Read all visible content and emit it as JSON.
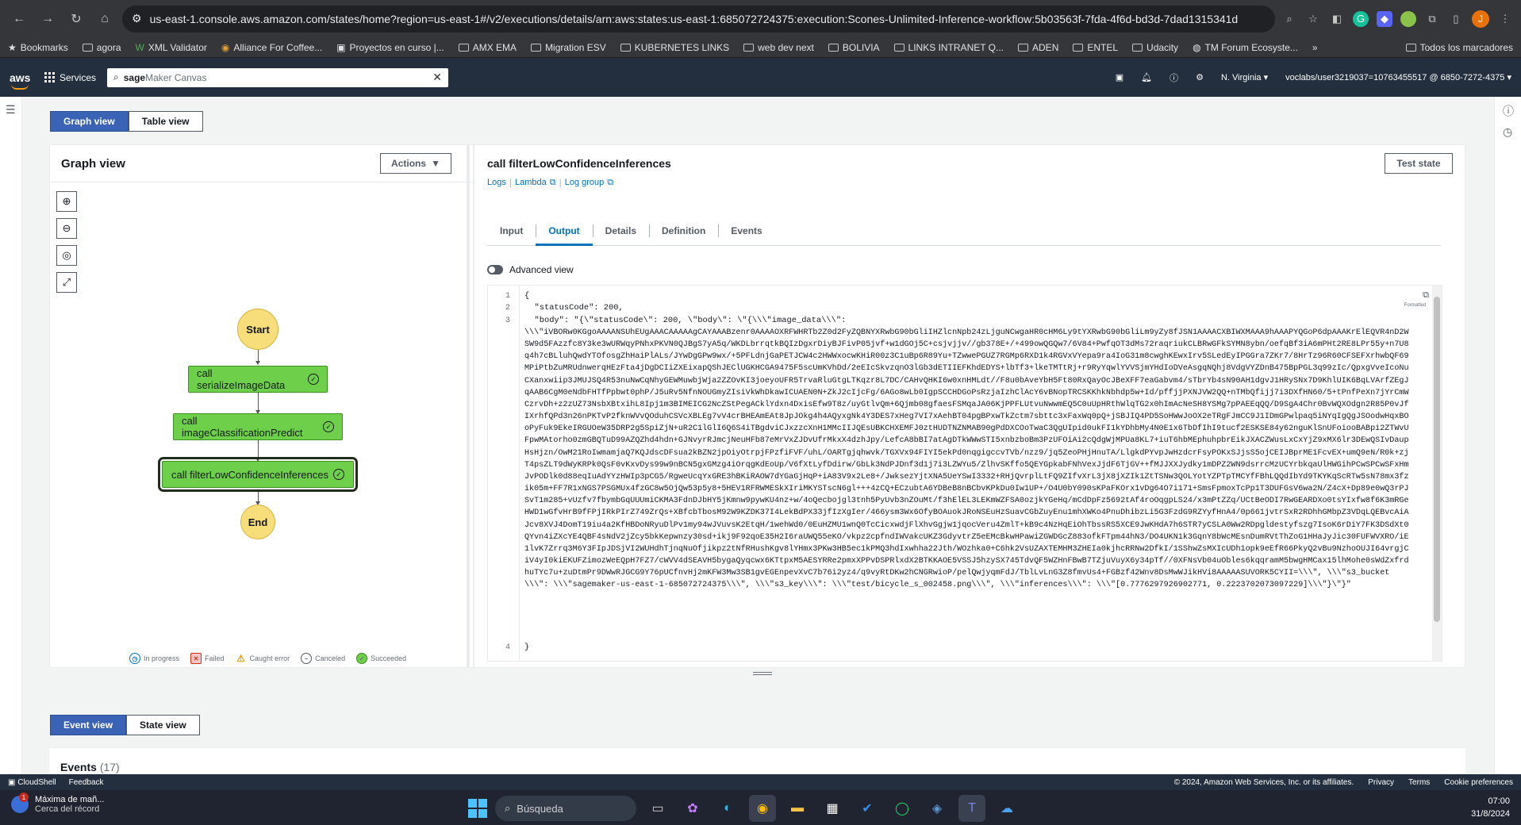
{
  "browser": {
    "url": "us-east-1.console.aws.amazon.com/states/home?region=us-east-1#/v2/executions/details/arn:aws:states:us-east-1:685072724375:execution:Scones-Unlimited-Inference-workflow:5b03563f-7fda-4f6d-bd3d-7dad1315341d",
    "bookmarks": [
      "Bookmarks",
      "agora",
      "XML Validator",
      "Alliance For Coffee...",
      "Proyectos en curso |...",
      "AMX EMA",
      "Migration ESV",
      "KUBERNETES LINKS",
      "web dev next",
      "BOLIVIA",
      "LINKS INTRANET Q...",
      "ADEN",
      "ENTEL",
      "Udacity",
      "TM Forum Ecosyste..."
    ],
    "more_bookmarks": "»",
    "all_bookmarks": "Todos los marcadores",
    "profile_initial": "J"
  },
  "aws_header": {
    "logo": "aws",
    "services": "Services",
    "search_highlight": "sage",
    "search_rest": "Maker Canvas",
    "region": "N. Virginia ▾",
    "account": "voclabs/user3219037=10763455517 @ 6850-7272-4375 ▾"
  },
  "view_toggle": {
    "graph": "Graph view",
    "table": "Table view"
  },
  "graph_panel": {
    "title": "Graph view",
    "actions": "Actions",
    "nodes": {
      "start": "Start",
      "serialize": "call serializeImageData",
      "classify": "call imageClassificationPredict",
      "filter": "call filterLowConfidenceInferences",
      "end": "End"
    },
    "legend": [
      "In progress",
      "Failed",
      "Caught error",
      "Canceled",
      "Succeeded"
    ]
  },
  "details_panel": {
    "title": "call filterLowConfidenceInferences",
    "links": [
      "Logs",
      "Lambda",
      "Log group"
    ],
    "test_state": "Test state",
    "tabs": [
      "Input",
      "Output",
      "Details",
      "Definition",
      "Events"
    ],
    "active_tab": "Output",
    "advanced_view": "Advanced view",
    "formatted_label": "Formatted",
    "code_lines": [
      "1",
      "2",
      "3",
      "4"
    ],
    "code": {
      "line1": "{",
      "line2": "  \"statusCode\": 200,",
      "line3_head": "  \"body\": \"{\\\"statusCode\\\": 200, \\\"body\\\": \\\"{\\\\\\\"image_data\\\\\\\":",
      "line3_blob": "\\\\\\\"iVBORw0KGgoAAAANSUhEUgAAACAAAAAgCAYAAABzenr0AAAAOXRFWHRTb2Z0d2FyZQBNYXRwbG90bGliIHZlcnNpb24zLjguNCwgaHR0cHM6Ly9tYXRwbG90bGliLm9yZy8fJSN1AAAACXBIWXMAAA9hAAAPYQGoP6dpAAAKrElEQVR4nD2WSW9d5FAzzfc8Y3ke3wURWqyPNhxPKVN0QJBgS7yA5q/WKDLbrrqtkBQIzDgxrDiyBJFivP05jvf+w1dGOj5C+csjvjjv//gb378E+/+499owQGQw7/6V84+PwfqOT3dMs72raqriukCLBRwGFkSYMN8ybn/oefqBf3iA6mPHt2RE8LPr55y+n7U8q4h7cBLluhQwdYTOfosgZhHaiPlALs/JYwDgGPw9wx/+5PFLdnjGaPETJCW4c2HWWxocwKHiR00z3C1uBp6R89Yu+TZwwePGUZ7RGMp6RXD1k4RGVxVYepa9ra4IoG31m8cwghKEwxIrv5SLedEyIPGGra7ZKr7/8HrTz96R60CFSEFXrhwbQF69MPiPtbZuMRUdnwerqHEzFta4jDgDCIiZXEixapQShJEClUGKHCGA9475F5scUmKVhDd/2eEIcSkvzqnO3lGb3dETIIEFKhdEDYS+lbTf3+lkeTMTtRj+r9RyYqwlYVVSjmYHdIoDVeAsgqNQhj8VdgVYZDnB475BpPGL3q99zIc/QpxgVveIcoNuCXanxwiip3JMUJSQ4R53nuNwCqNhyGEWMuwbjWja2ZZOvKI3joeyoUFR5TrvaRluGtgLTKqzr8L7DC/CAHvQHKI6w0xnHMLdt//F8u0bAveYbH5Ft80RxQayOcJBeXFF7eaGabvm4/sTbrYb4sN90AH1dgvJ1HRySNx7D9KhlUIK6BqLVArfZEgJqAAB6CgM0eNdbFHTfPpbwt0phP/J5uRv5NfnNOUGmyZIsiVkWhDkawICUAEN0N+ZkJ2cIjcFg/6AGo8wLb0IgpSCCHDGoPsRzjaIzhClAcY6vBNopTRCSKKhkNbhdp5w+Id/pffjjPXNJVW2QQ+nTMbQfijj7i3DXfHN60/5+tPnfPeXn7jYrCmWCzrvDh+z2zUZ73NsbXBtxihL8Ipj1m3BIMEICG2NcZStPegACklYdxn4DxisEfw9T8z/uyGtlvQm+6Qjmb08gfaesFSMqaJA06KjPPFLUtvuNwwmEQ5C0uUpHRthWlqTG2x0hImAcNeSH8YSMg7pPAEEqQQ/D9SgA4Chr0BvWQXOdgn2R85P0vJfIXrhfQPd3n26nPKTvP2fknWVvQOduhCSVcXBLEg7vV4crBHEAmEAt8JpJOkg4h4AQyxgNk4Y3DES7xHeg7VI7xAehBT04pgBPxwTkZctm7sbttc3xFaxWq0pQ+jSBJIQ4PD5SoHWwJoOX2eTRgFJmCC9J1IDmGPwlpaq5iNYqIgQgJSOodwHqxBOoPyFuk9EkeIRGUOeW35DRP2g5SpiZjN+uR2C1lGlI6Q6S4iTBgdviCJxzzcXnH1MMcIIJQEsUBKCHXEMFJ0ztHUDTNZNMAB90gPdDXCOoTwaC3QgUIpid0ukFI1kYDhbMy4N0E1x6TbDfIhI9tucf2ESKSE84y62nguKlSnUFoiooBABpi2ZTWvUFpwMAtorho0zmGBQTuD99AZQZhd4hdn+GJNvyrRJmcjNeuHFb87eMrVxZJDvUfrMkxX4dzhJpy/LefcA8bBI7atAgDTkWWwSTI5xnbzboBm3PzUFOiAi2cQdgWjMPUa8KL7+iuT6hbMEphuhpbrEikJXACZWusLxCxYjZ9xMX6lr3DEwQSIvDaupHsHjzn/OwM21RoIwmamjaQ7KQJdscDFsua2kBZN2jpOiyOtrpjFPzfiFVF/uhL/OARTgjqhwvk/TGXVx94FIYI5ekPd0nqgigccvTVb/nzz9/jq5ZeoPHjHnuTA/LlgkdPYvpJwHzdcrFsyPOKxSJjsS5ojCEIJBprME1FcvEX+umQ9eN/R0k+zjT4psZLT9dWyKRPk0QsF0vKxvDys99w9nBCN5gxGMzg4iOrqgKdEoUp/V6fXtLyfDdirw/GbLk3NdPJDnf3d1j7i3LZWYu5/ZlhvSKffo5QEYGpkabFNhVexJjdF6TjGV++fMJJXXJydky1mDPZ2WN9dsrrcMzUCYrbkqaUlHWGihPCwSPCwSFxHmJvPODlk0d88eqIuAdYYzHWIp3pCG5/RgweUcqYxGRE3hBKiRAOW7dYGaGjHqP+iA83V9x2Le8+/JwksezYjtXNA5UeYSwI3332+RHjQvrplLtFQ9ZIfvXrL3jX8jXZIk1ZtTSNw3QOLYotYZPTpTMCYfFBhLQQdIbYd9TKYKqScRTw5sN78mx3fzik05m+FF7R1xNGS7PSGMUx4fzGC8w5OjQw53p5y8+5HEV1RFRWMESkXIriMKYSTscN6gl+++4zCQ+ECzubtA6YDBeB8nBCbvKPkDu0Iw1UP+/O4U0bY090sKPaFKOrx1vDg64O7i171+SmsFpmoxTcPp1T3DUFGsV6wa2N/Z4cX+Dp89e0wQ3rPJSvT1m285+vUzfv7fbymbGqUUUmiCKMA3FdnDJbHY5jKmnw9pywKU4nz+w/4oQecbojgl3tnh5PyUvb3nZOuMt/f3hElEL3LEKmWZFSA0ozjkYGeHq/mCdDpFz5692tAf4roOqgpLS24/x3mPtZZq/UCtBeODI7RwGEARDXo0tsYIxfw8f6K3mRGeHWD1wGfvHrB9fFPjIRkPIrZ749ZrQs+XBfcbTbosM92W9KZDK37I4LekBdPX33jfIzXgIer/466ysm3Wx6OfyBOAuokJRoNSEuHzSuavCGbZuyEnu1mhXWKo4PnuDhibzLi5G3FzdG9RZYyfHnA4/0p661jvtrSxR2RDhhGMbpZ3VDqLQEBvcAiAJcv8XVJ4DomT19iu4a2KfHBDoNRyuDlPv1my94wJVuvsK2EtqH/1wehWd0/0EuHZMU1wnQ0TcCicxwdjFlXhvGgjw1jqocVeru4ZmlT+kB9c4NzHqEiOhTbssRS5XCE9JwKHdA7h6STR7yCSLA0Ww2RDpgldestyfszg7IsoK6rDiY7FK3DSdXt0QYvn4iZXcYE4QBF4sNdV2jZcy5bkKepwnzy30sd+ikj9F92qoE35H2I6raUWQ55eKO/vkpz2cpfndIWVakcUKZ3GdyvtrZ5eEMcBkwHPawiZGWDGcZ883ofkFTpm44hN3/DO4UKN1k3GqnY8bWcMEsnDumRVtThZoG1HHaJyJic30FUFWVXRO/iE1lvK7Zrrq3M6Y3FIpJDSjVI2WUHdhTjnqNuOfjikpz2tNfRHushKgv8lYHmx3PKw3HB5ec1kPMQ3hdIxwhha22Jth/WOzhka0+C6hk2VsUZAXTEMHM3ZHEIa0kjhcRRNw2DfkI/1SShwZsMXIcUDh1opk9eEfR66PkyQ2vBu9NzhoOUJI64vrgjCiV4yI0kiEKUFZimozWeEQpH7FZ7/cWVV4dSEAVH5bygaQyqcwx6KTtpxM5AESYRRe2pmxXPPvDSPRlxdX2BTKKAOE5VSSJ5hzySX745TdvQF5WZHnFBwB7TZjuVuyX6y34pTf//0XFNsVb04uObles6kqqramM5bwgHMCax15lhMohe0sWdZxfrdhuTYc7u+zuDtmPr9DWwRJGCG9Y76pUCfnvHj2mKFW3Mw3SB1gvEGEnpevXvC7b76i2yz4/q9vyRtDKw2hCNGRwioP/pelQwjyqmFdJ/TblLvLnG3Z8fmvUs4+FGBzf42Wnv8DsMwWJikHVi8AAAAASUVORK5CYII=\\\\\\\", \\\\\\\"s3_bucket\\\\\\\": \\\\\\\"sagemaker-us-east-1-685072724375\\\\\\\", \\\\\\\"s3_key\\\\\\\": \\\\\\\"test/bicycle_s_002458.png\\\\\\\", \\\\\\\"inferences\\\\\\\": \\\\\\\"[0.7776297926902771, 0.2223702073097229]\\\\\\\"}\\\"}\"",
      "line4": "}"
    }
  },
  "bottom_toggle": {
    "event": "Event view",
    "state": "State view"
  },
  "events": {
    "label": "Events",
    "count": "(17)"
  },
  "aws_footer": {
    "cloudshell": "CloudShell",
    "feedback": "Feedback",
    "copyright": "© 2024, Amazon Web Services, Inc. or its affiliates.",
    "privacy": "Privacy",
    "terms": "Terms",
    "cookies": "Cookie preferences"
  },
  "taskbar": {
    "weather_title": "Máxima de mañ...",
    "weather_sub": "Cerca del récord",
    "weather_badge": "1",
    "search": "Búsqueda",
    "time": "07:00",
    "date": "31/8/2024"
  }
}
